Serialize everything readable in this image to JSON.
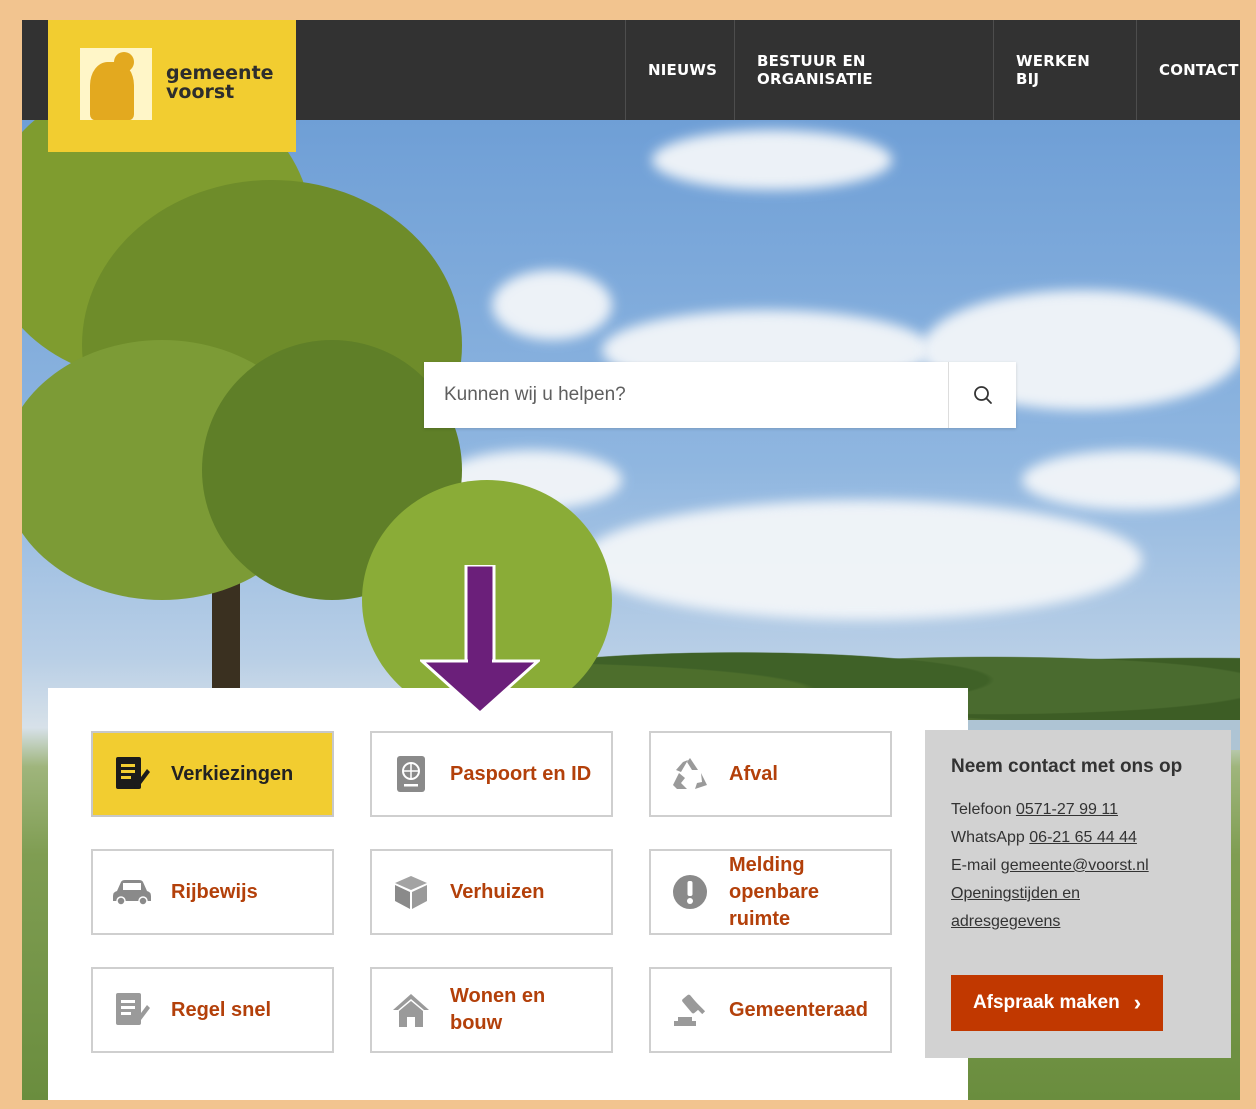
{
  "header": {
    "logo_line1": "gemeente",
    "logo_line2": "voorst",
    "nav": [
      "NIEUWS",
      "BESTUUR EN ORGANISATIE",
      "WERKEN BIJ",
      "CONTACT"
    ]
  },
  "search": {
    "placeholder": "Kunnen wij u helpen?"
  },
  "tiles": [
    {
      "label": "Verkiezingen",
      "icon": "ballot-icon"
    },
    {
      "label": "Paspoort en ID",
      "icon": "passport-icon"
    },
    {
      "label": "Afval",
      "icon": "recycle-icon"
    },
    {
      "label": "Rijbewijs",
      "icon": "car-icon"
    },
    {
      "label": "Verhuizen",
      "icon": "box-icon"
    },
    {
      "label": "Melding openbare ruimte",
      "icon": "alert-icon"
    },
    {
      "label": "Regel snel",
      "icon": "form-icon"
    },
    {
      "label": "Wonen en bouw",
      "icon": "house-icon"
    },
    {
      "label": "Gemeenteraad",
      "icon": "gavel-icon"
    }
  ],
  "contact": {
    "title": "Neem contact met ons op",
    "phone_label": "Telefoon",
    "phone": "0571-27 99 11",
    "whatsapp_label": "WhatsApp",
    "whatsapp": "06-21 65 44 44",
    "email_label": "E-mail",
    "email": "gemeente@voorst.nl",
    "hours_link": "Openingstijden en adresgegevens",
    "cta": "Afspraak maken",
    "cta_chevron": "›"
  },
  "colors": {
    "header_bg": "#323232",
    "logo_yellow": "#f2cd30",
    "tile_label": "#b3400a",
    "cta_bg": "#c13800",
    "annotation_arrow": "#6b1f7a"
  }
}
